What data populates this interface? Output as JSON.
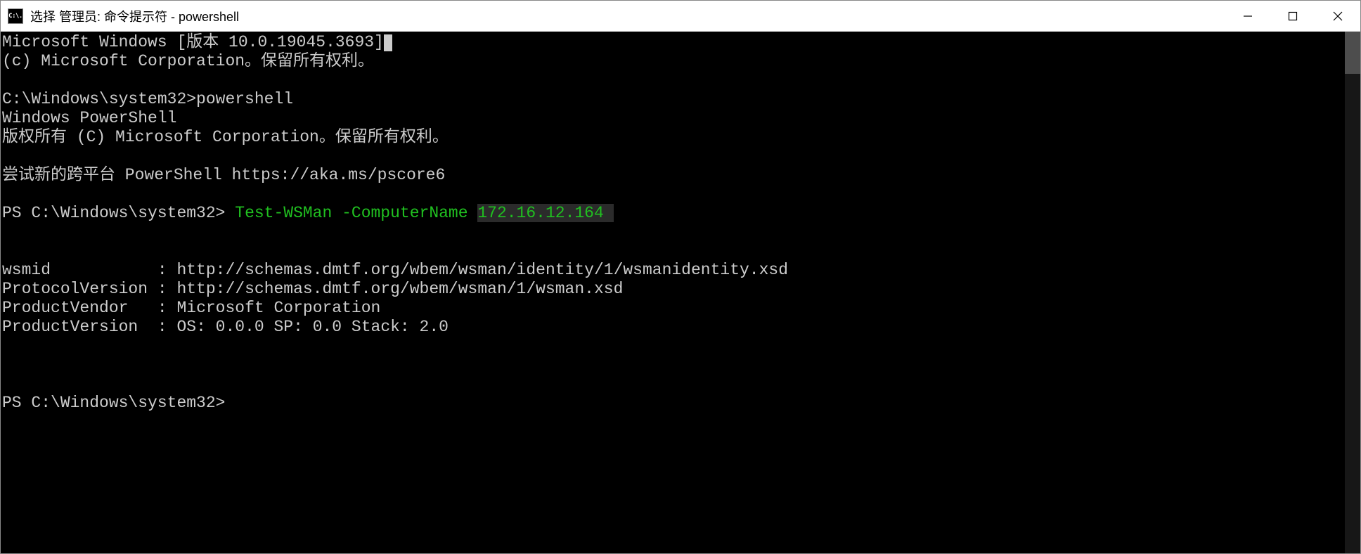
{
  "titlebar": {
    "icon_label": "C:\\.",
    "title": "选择 管理员: 命令提示符 - powershell"
  },
  "terminal": {
    "lines": [
      {
        "type": "plain",
        "text": "Microsoft Windows [版本 10.0.19045.3693]",
        "cursor_after": true
      },
      {
        "type": "plain",
        "text": "(c) Microsoft Corporation。保留所有权利。"
      },
      {
        "type": "blank"
      },
      {
        "type": "plain",
        "text": "C:\\Windows\\system32>powershell"
      },
      {
        "type": "plain",
        "text": "Windows PowerShell"
      },
      {
        "type": "plain",
        "text": "版权所有 (C) Microsoft Corporation。保留所有权利。"
      },
      {
        "type": "blank"
      },
      {
        "type": "plain",
        "text": "尝试新的跨平台 PowerShell https://aka.ms/pscore6"
      },
      {
        "type": "blank"
      },
      {
        "type": "ps_cmd",
        "prompt": "PS C:\\Windows\\system32> ",
        "cmd": "Test-WSMan",
        "param": " -ComputerName ",
        "arg": "172.16.12.164",
        "selected_trail": true
      },
      {
        "type": "blank"
      },
      {
        "type": "blank"
      },
      {
        "type": "kv",
        "key": "wsmid          ",
        "sep": " : ",
        "val": "http://schemas.dmtf.org/wbem/wsman/identity/1/wsmanidentity.xsd"
      },
      {
        "type": "kv",
        "key": "ProtocolVersion",
        "sep": " : ",
        "val": "http://schemas.dmtf.org/wbem/wsman/1/wsman.xsd"
      },
      {
        "type": "kv",
        "key": "ProductVendor  ",
        "sep": " : ",
        "val": "Microsoft Corporation"
      },
      {
        "type": "kv",
        "key": "ProductVersion ",
        "sep": " : ",
        "val": "OS: 0.0.0 SP: 0.0 Stack: 2.0"
      },
      {
        "type": "blank"
      },
      {
        "type": "blank"
      },
      {
        "type": "blank"
      },
      {
        "type": "plain",
        "text": "PS C:\\Windows\\system32>"
      }
    ]
  }
}
